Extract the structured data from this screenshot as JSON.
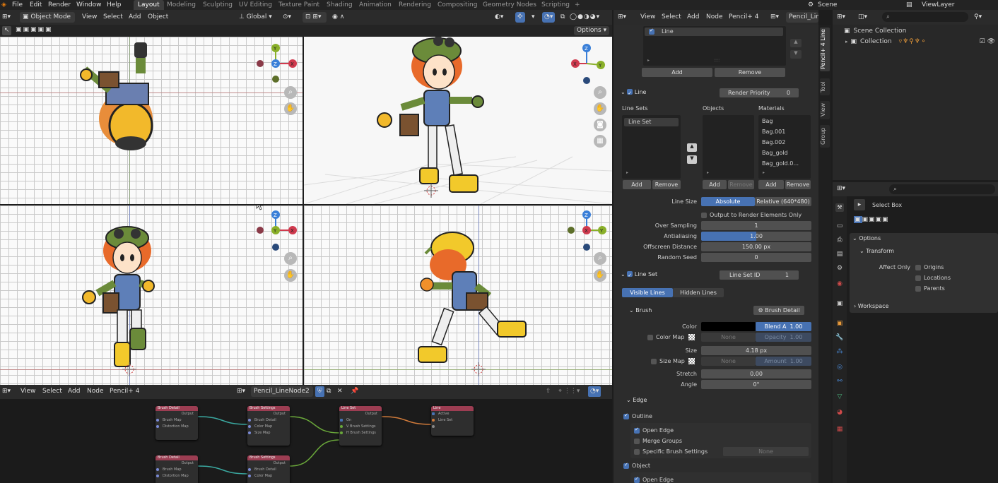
{
  "menubar": {
    "items": [
      "File",
      "Edit",
      "Render",
      "Window",
      "Help"
    ],
    "workspace_tabs": [
      "Layout",
      "Modeling",
      "Sculpting",
      "UV Editing",
      "Texture Paint",
      "Shading",
      "Animation",
      "Rendering",
      "Compositing",
      "Geometry Nodes",
      "Scripting"
    ],
    "add_tab": "+",
    "scene": "Scene",
    "view_layer": "ViewLayer"
  },
  "viewport_header": {
    "mode": "Object Mode",
    "view": "View",
    "select": "Select",
    "add": "Add",
    "object": "Object",
    "orientation": "Global",
    "options": "Options"
  },
  "gizmo": {
    "x": "X",
    "y": "Y",
    "z": "Z"
  },
  "node_editor": {
    "view": "View",
    "select": "Select",
    "add": "Add",
    "node": "Node",
    "tree_type": "Pencil+ 4",
    "tree_name": "Pencil_LineNode2",
    "nodes": [
      {
        "title": "Brush Detail",
        "output": "Output",
        "rows": [
          "Brush Map",
          "Distortion Map"
        ]
      },
      {
        "title": "Brush Settings",
        "output": "Output",
        "rows": [
          "Brush Detail",
          "Color Map",
          "Size Map"
        ]
      },
      {
        "title": "Line Set",
        "output": "Output",
        "rows": [
          "On",
          "V Brush Settings",
          "H Brush Settings"
        ]
      },
      {
        "title": "Line",
        "output": "",
        "rows": [
          "Active",
          "Line Set"
        ]
      },
      {
        "title": "Brush Detail",
        "output": "Output",
        "rows": [
          "Brush Map",
          "Distortion Map"
        ]
      },
      {
        "title": "Brush Settings",
        "output": "Output",
        "rows": [
          "Brush Detail",
          "Color Map"
        ]
      }
    ]
  },
  "props_header": {
    "view": "View",
    "select": "Select",
    "add": "Add",
    "node": "Node",
    "tree_type": "Pencil+ 4",
    "tree_name": "Pencil_LineNoc"
  },
  "props": {
    "line_list_item": "Line",
    "add": "Add",
    "remove": "Remove",
    "line_panel": "Line",
    "render_priority_label": "Render Priority",
    "render_priority": "0",
    "col_line_sets": "Line Sets",
    "col_objects": "Objects",
    "col_materials": "Materials",
    "line_set_item": "Line Set",
    "materials": [
      "Bag",
      "Bag.001",
      "Bag.002",
      "Bag_gold",
      "Bag_gold.0..."
    ],
    "line_size_label": "Line Size",
    "line_size_abs": "Absolute",
    "line_size_rel": "Relative (640*480)",
    "output_render_elements": "Output to Render Elements Only",
    "over_sampling_label": "Over Sampling",
    "over_sampling": "1",
    "antialiasing_label": "Antialiasing",
    "antialiasing": "1.00",
    "offscreen_label": "Offscreen Distance",
    "offscreen": "150.00 px",
    "random_seed_label": "Random Seed",
    "random_seed": "0",
    "line_set_panel": "Line Set",
    "line_set_id_label": "Line Set ID",
    "line_set_id": "1",
    "visible_lines": "Visible Lines",
    "hidden_lines": "Hidden Lines",
    "brush_panel": "Brush",
    "brush_detail": "Brush Detail",
    "color_label": "Color",
    "blend_label": "Blend A",
    "blend_value": "1.00",
    "color_map_label": "Color Map",
    "none": "None",
    "opacity_label": "Opacity",
    "opacity_value": "1.00",
    "size_label": "Size",
    "size": "4.18 px",
    "size_map_label": "Size Map",
    "amount_label": "Amount",
    "amount_value": "1.00",
    "stretch_label": "Stretch",
    "stretch": "0.00",
    "angle_label": "Angle",
    "angle": "0°",
    "edge_panel": "Edge",
    "outline_label": "Outline",
    "open_edge": "Open Edge",
    "merge_groups": "Merge Groups",
    "specific_brush": "Specific Brush Settings",
    "object_label": "Object",
    "open_edge2": "Open Edge"
  },
  "side_tabs": [
    "Pencil+ 4 Line",
    "Tool",
    "View",
    "Group"
  ],
  "outliner": {
    "scene_collection": "Scene Collection",
    "collection": "Collection"
  },
  "tool_panel": {
    "select_box": "Select Box",
    "options": "Options",
    "transform": "Transform",
    "affect_only": "Affect Only",
    "origins": "Origins",
    "locations": "Locations",
    "parents": "Parents",
    "workspace": "Workspace"
  },
  "colors": {
    "accent": "#4772b3",
    "node_header": "#9c3d52",
    "x_axis": "#d03a4e",
    "y_axis": "#8ab02a",
    "z_axis": "#3a7fd8"
  }
}
